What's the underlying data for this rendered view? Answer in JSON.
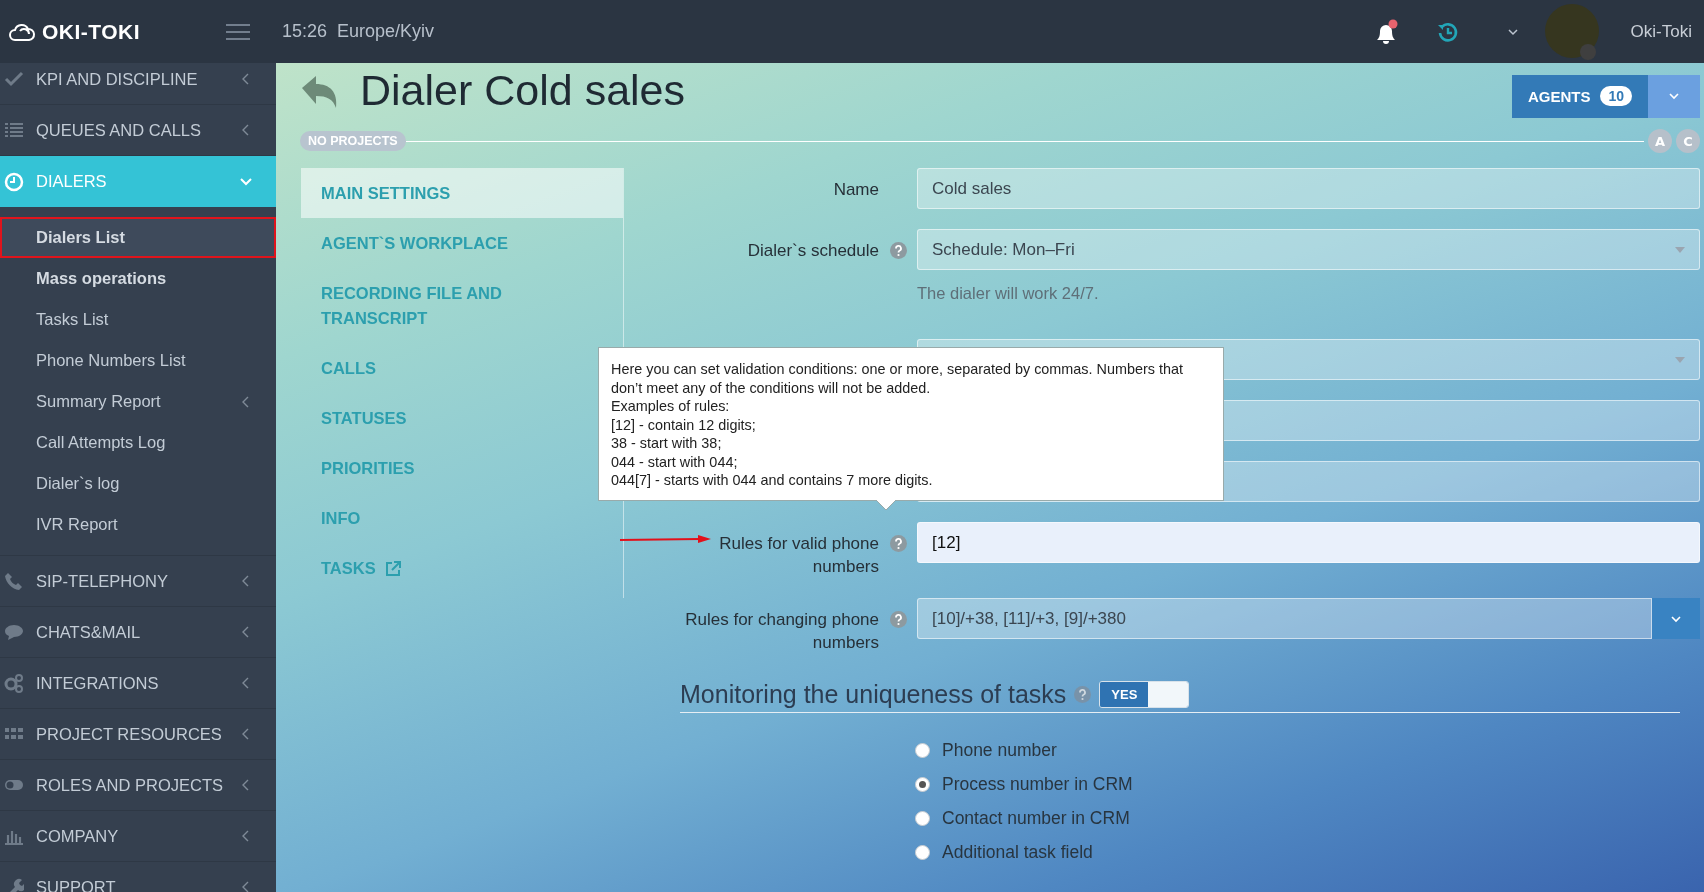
{
  "topbar": {
    "brand": "OKI-TOKI",
    "time": "15:26",
    "timezone": "Europe/Kyiv",
    "user": "Oki-Toki",
    "notifications_unread": true
  },
  "sidebar": {
    "items": [
      {
        "label": "KPI AND DISCIPLINE",
        "expanded": false,
        "selected": false
      },
      {
        "label": "QUEUES AND CALLS",
        "expanded": false,
        "selected": false
      },
      {
        "label": "DIALERS",
        "expanded": true,
        "selected": true,
        "children": [
          {
            "label": "Dialers List",
            "selected": true,
            "bold": true,
            "annotated": true,
            "has_submenu": false
          },
          {
            "label": "Mass operations",
            "selected": false,
            "bold": true,
            "annotated": false,
            "has_submenu": false
          },
          {
            "label": "Tasks List",
            "selected": false,
            "bold": false,
            "annotated": false,
            "has_submenu": false
          },
          {
            "label": "Phone Numbers List",
            "selected": false,
            "bold": false,
            "annotated": false,
            "has_submenu": false
          },
          {
            "label": "Summary Report",
            "selected": false,
            "bold": false,
            "annotated": false,
            "has_submenu": true
          },
          {
            "label": "Call Attempts Log",
            "selected": false,
            "bold": false,
            "annotated": false,
            "has_submenu": false
          },
          {
            "label": "Dialer`s log",
            "selected": false,
            "bold": false,
            "annotated": false,
            "has_submenu": false
          },
          {
            "label": "IVR Report",
            "selected": false,
            "bold": false,
            "annotated": false,
            "has_submenu": false
          }
        ]
      },
      {
        "label": "SIP-TELEPHONY",
        "expanded": false,
        "selected": false
      },
      {
        "label": "CHATS&MAIL",
        "expanded": false,
        "selected": false
      },
      {
        "label": "INTEGRATIONS",
        "expanded": false,
        "selected": false
      },
      {
        "label": "PROJECT RESOURCES",
        "expanded": false,
        "selected": false
      },
      {
        "label": "ROLES AND PROJECTS",
        "expanded": false,
        "selected": false
      },
      {
        "label": "COMPANY",
        "expanded": false,
        "selected": false
      },
      {
        "label": "SUPPORT",
        "expanded": false,
        "selected": false
      }
    ]
  },
  "page": {
    "title": "Dialer Cold sales",
    "project_badge": "NO PROJECTS",
    "agents_button": {
      "label": "AGENTS",
      "count": "10"
    },
    "markers": [
      "A",
      "C"
    ]
  },
  "tabs": [
    {
      "label": "MAIN SETTINGS",
      "selected": true,
      "external": false
    },
    {
      "label": "AGENT`S WORKPLACE",
      "selected": false,
      "external": false
    },
    {
      "label": "RECORDING FILE AND TRANSCRIPT",
      "selected": false,
      "external": false
    },
    {
      "label": "CALLS",
      "selected": false,
      "external": false
    },
    {
      "label": "STATUSES",
      "selected": false,
      "external": false
    },
    {
      "label": "PRIORITIES",
      "selected": false,
      "external": false
    },
    {
      "label": "INFO",
      "selected": false,
      "external": false
    },
    {
      "label": "TASKS",
      "selected": false,
      "external": true
    }
  ],
  "form": {
    "fields": [
      {
        "kind": "text",
        "label": "Name",
        "value": "Cold sales",
        "help": false,
        "focused": false
      },
      {
        "kind": "select",
        "label": "Dialer`s schedule",
        "value": "Schedule: Mon–Fri",
        "help": true,
        "focused": false,
        "hint": "The dialer will work 24/7."
      },
      {
        "kind": "select",
        "focused": false
      },
      {
        "kind": "text",
        "focused": false
      },
      {
        "kind": "text",
        "focused": false
      },
      {
        "kind": "text",
        "label": "Rules for valid phone numbers",
        "value": "[12]",
        "help": true,
        "focused": true,
        "annotated": true
      },
      {
        "kind": "combo",
        "label": "Rules for changing phone numbers",
        "value": "[10]/+38, [11]/+3, [9]/+380",
        "help": true,
        "focused": false
      }
    ]
  },
  "tooltip": {
    "lines": [
      "Here you can set validation conditions: one or more, separated by commas. Numbers that don’t meet any of the conditions will not be added.",
      "Examples of rules:",
      "[12] - contain 12 digits;",
      "38 - start with 38;",
      "044 - start with 044;",
      "044[7] - starts with 044 and contains 7 more digits."
    ]
  },
  "uniqueness": {
    "title": "Monitoring the uniqueness of tasks",
    "toggle": {
      "label": "YES",
      "on": true
    },
    "options": [
      {
        "label": "Phone number",
        "selected": false
      },
      {
        "label": "Process number in CRM",
        "selected": true
      },
      {
        "label": "Contact number in CRM",
        "selected": false
      },
      {
        "label": "Additional task field",
        "selected": false
      }
    ]
  }
}
